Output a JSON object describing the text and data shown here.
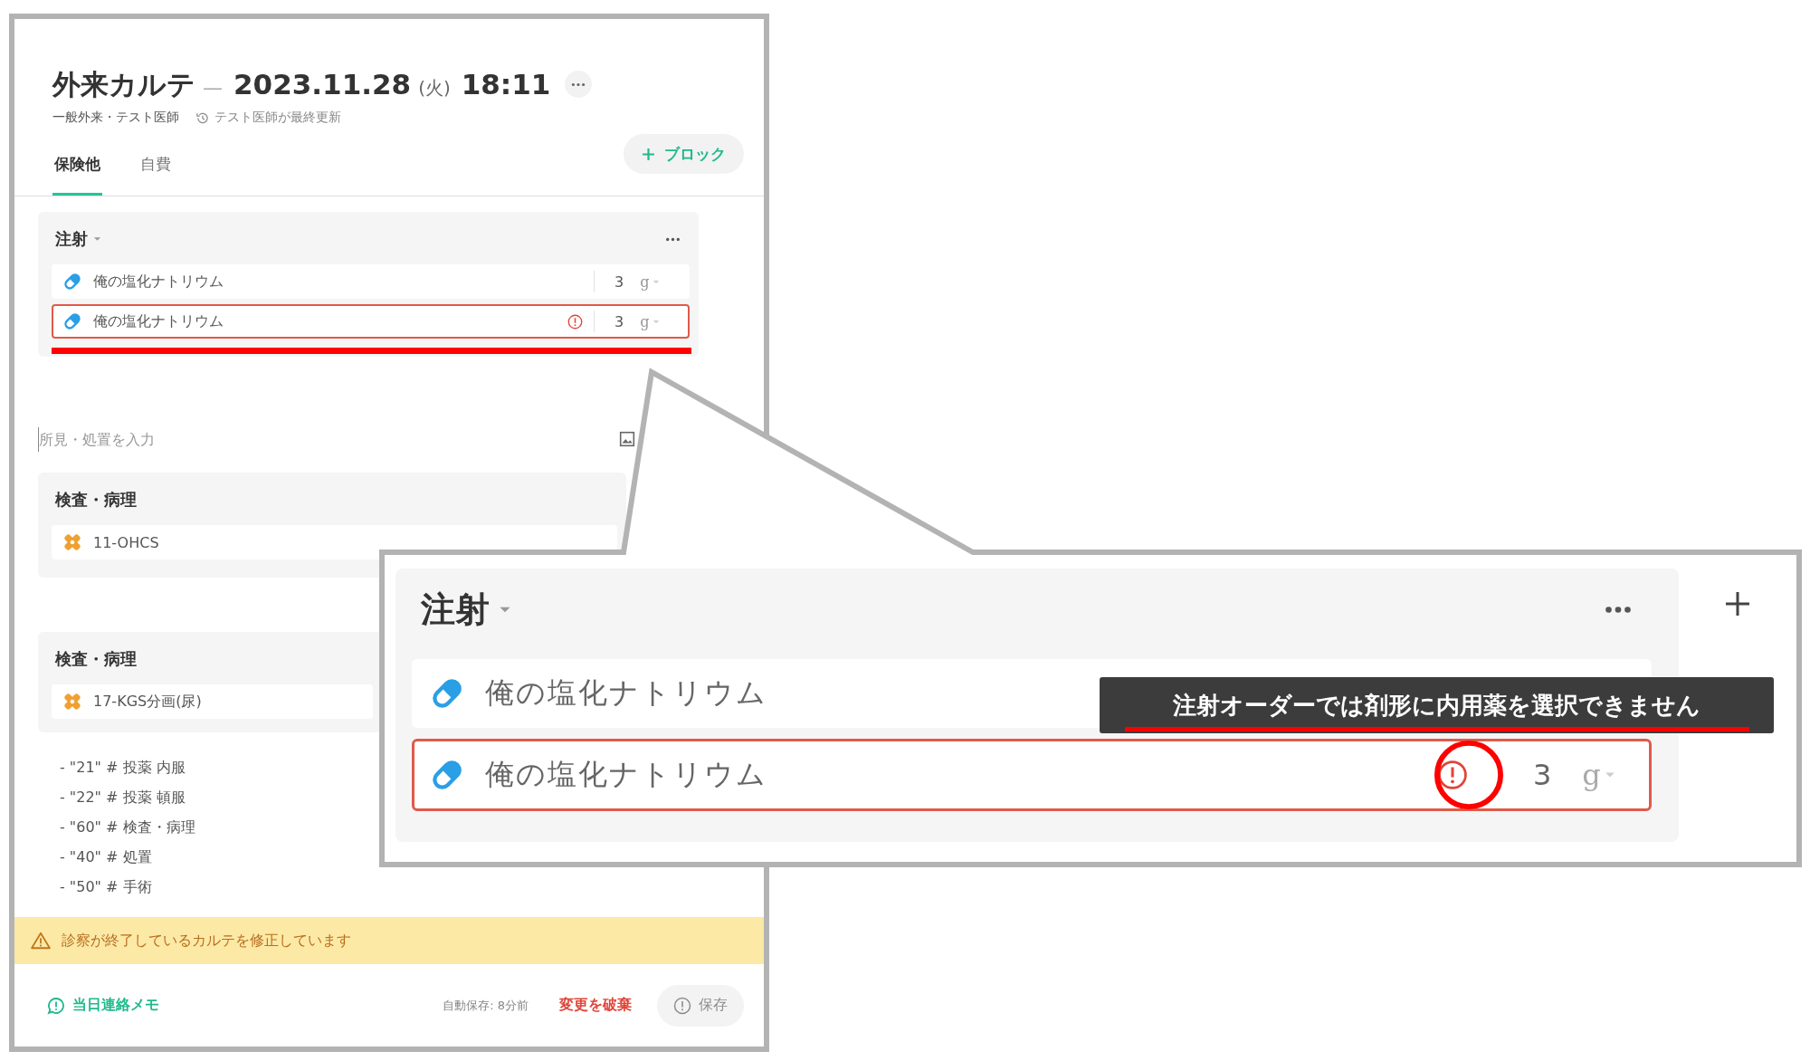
{
  "record": {
    "title": "外来カルテ",
    "separator": "—",
    "date": "2023.11.28",
    "weekday": "(火)",
    "time": "18:11",
    "department": "一般外来・テスト医師",
    "last_updated": "テスト医師が最終更新"
  },
  "tabs": [
    {
      "label": "保険他",
      "selected": true
    },
    {
      "label": "自費",
      "selected": false
    }
  ],
  "add_block_button": {
    "label": "ブロック"
  },
  "blocks": [
    {
      "title": "注射",
      "dropdown": true,
      "items": [
        {
          "kind": "drug",
          "name": "俺の塩化ナトリウム",
          "quantity": "3",
          "unit": "g",
          "error": false
        },
        {
          "kind": "drug",
          "name": "俺の塩化ナトリウム",
          "quantity": "3",
          "unit": "g",
          "error": true
        }
      ]
    },
    {
      "title": "検査・病理",
      "dropdown": false,
      "items": [
        {
          "kind": "test",
          "name": "11-OHCS",
          "error": false
        }
      ]
    },
    {
      "title": "検査・病理",
      "dropdown": false,
      "items": [
        {
          "kind": "test",
          "name": "17-KGS分画(尿)",
          "error": false
        }
      ]
    }
  ],
  "findings_field": {
    "placeholder": "所見・処置を入力"
  },
  "code_lines": [
    "- \"21\" # 投薬 内服",
    "- \"22\" # 投薬 頓服",
    "- \"60\" # 検査・病理",
    "- \"40\" # 処置",
    "- \"50\" # 手術"
  ],
  "warning_banner": {
    "text": "診察が終了しているカルテを修正しています"
  },
  "footer": {
    "memo_link": "当日連絡メモ",
    "autosave": "自動保存: 8分前",
    "discard_button": "変更を破棄",
    "save_button": {
      "label": "保存",
      "disabled": true
    }
  },
  "callout": {
    "block_title": "注射",
    "items": [
      {
        "name": "俺の塩化ナトリウム",
        "error": false
      },
      {
        "name": "俺の塩化ナトリウム",
        "quantity": "3",
        "unit": "g",
        "error": true
      }
    ],
    "tooltip": "注射オーダーでは剤形に内用薬を選択できません"
  }
}
